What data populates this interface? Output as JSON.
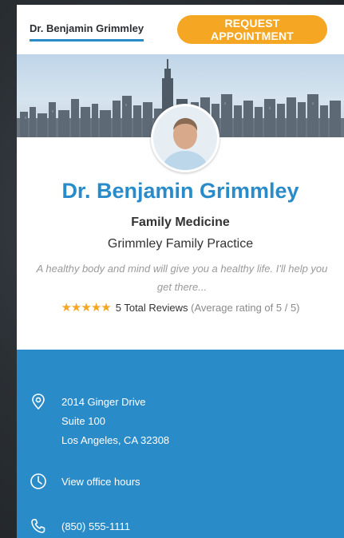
{
  "header": {
    "doctor_link": "Dr. Benjamin Grimmley",
    "request_button": "REQUEST APPOINTMENT"
  },
  "profile": {
    "name": "Dr. Benjamin Grimmley",
    "specialty": "Family Medicine",
    "practice": "Grimmley Family Practice",
    "tagline": "A healthy body and mind will give you a healthy life. I'll help you get there...",
    "stars": "★★★★★",
    "rating": 5,
    "reviews_label": "5 Total Reviews",
    "rating_note": "(Average rating of 5 / 5)"
  },
  "contact": {
    "address_line1": "2014 Ginger Drive",
    "address_line2": "Suite 100",
    "address_line3": "Los Angeles, CA 32308",
    "hours_link": "View office hours",
    "phone": "(850) 555-1111"
  },
  "icons": [
    "location-pin-icon",
    "clock-icon",
    "phone-icon"
  ],
  "colors": {
    "accent": "#2a8bc9",
    "button": "#f5a623",
    "star": "#f5a623",
    "background": "#2a2f34"
  }
}
